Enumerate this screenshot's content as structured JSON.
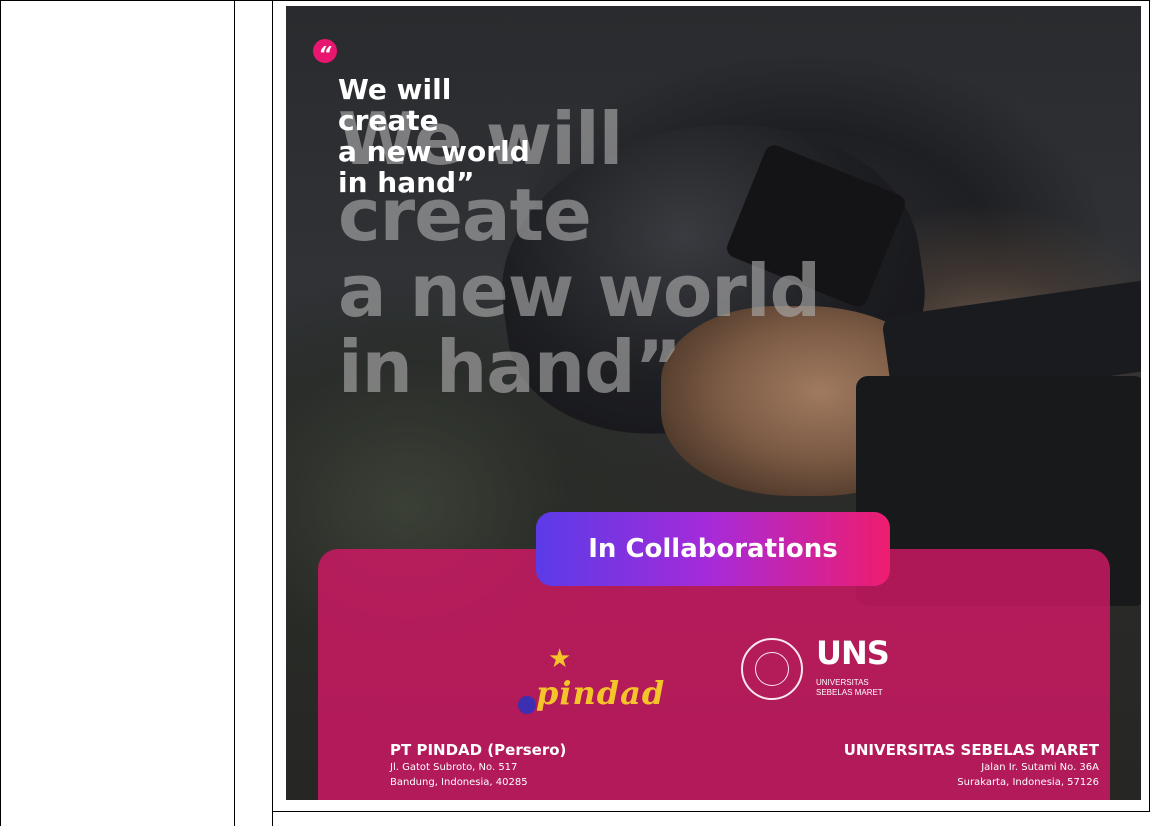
{
  "poster": {
    "quote_lines": [
      "We will",
      "create",
      "a new world",
      "in hand”"
    ],
    "quote_mark": "“",
    "collab_label": "In Collaborations",
    "partners": [
      {
        "logo_text": "pindad",
        "name": "PT PINDAD (Persero)",
        "address": "Jl. Gatot Subroto, No. 517",
        "city": "Bandung, Indonesia, 40285"
      },
      {
        "logo_text": "UNS",
        "logo_subtext_1": "UNIVERSITAS",
        "logo_subtext_2": "SEBELAS MARET",
        "name": "UNIVERSITAS SEBELAS MARET",
        "address": "Jalan Ir. Sutami No. 36A",
        "city": "Surakarta, Indonesia, 57126"
      }
    ]
  },
  "colors": {
    "accent_pink": "#e8166e",
    "panel_pink": "#d61866",
    "pill_start": "#5b3be8",
    "pill_end": "#ee1d6e",
    "pindad_yellow": "#f4c52a"
  }
}
